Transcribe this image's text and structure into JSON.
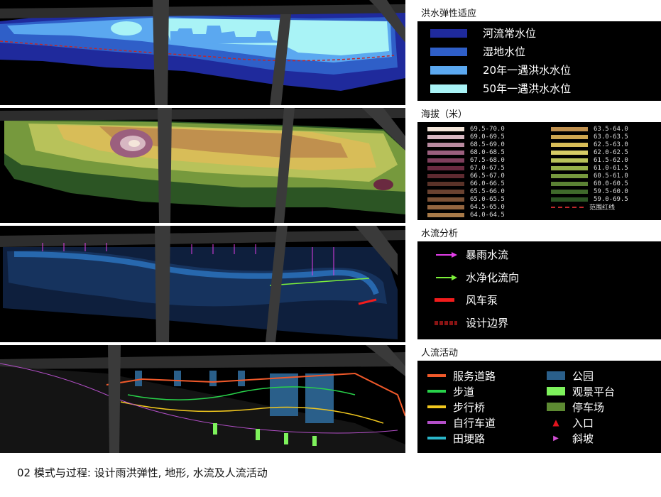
{
  "caption": "02 模式与过程: 设计雨洪弹性, 地形, 水流及人流活动",
  "flood": {
    "title": "洪水弹性适应",
    "items": [
      {
        "label": "河流常水位",
        "color": "#1f2a9c"
      },
      {
        "label": "湿地水位",
        "color": "#2f5fc8"
      },
      {
        "label": "20年一遇洪水水位",
        "color": "#5ba8f0"
      },
      {
        "label": "50年一遇洪水水位",
        "color": "#a9f3f6"
      }
    ]
  },
  "elevation": {
    "title": "海拔（米）",
    "left": [
      {
        "label": "69.5-70.0",
        "color": "#f4e6da"
      },
      {
        "label": "69.0-69.5",
        "color": "#d7b7c2"
      },
      {
        "label": "68.5-69.0",
        "color": "#b98aa0"
      },
      {
        "label": "68.0-68.5",
        "color": "#9b5f7e"
      },
      {
        "label": "67.5-68.0",
        "color": "#7f3f5d"
      },
      {
        "label": "67.0-67.5",
        "color": "#6a2a40"
      },
      {
        "label": "66.5-67.0",
        "color": "#5e2a30"
      },
      {
        "label": "66.0-66.5",
        "color": "#5a3228"
      },
      {
        "label": "65.5-66.0",
        "color": "#6a4230"
      },
      {
        "label": "65.0-65.5",
        "color": "#7c5236"
      },
      {
        "label": "64.5-65.0",
        "color": "#946640"
      },
      {
        "label": "64.0-64.5",
        "color": "#a87a48"
      }
    ],
    "right": [
      {
        "label": "63.5-64.0",
        "color": "#c0904e"
      },
      {
        "label": "63.0-63.5",
        "color": "#cfa650"
      },
      {
        "label": "62.5-63.0",
        "color": "#d8bd58"
      },
      {
        "label": "62.0-62.5",
        "color": "#d6cc66"
      },
      {
        "label": "61.5-62.0",
        "color": "#b8c25a"
      },
      {
        "label": "61.0-61.5",
        "color": "#95b049"
      },
      {
        "label": "60.5-61.0",
        "color": "#76993d"
      },
      {
        "label": "60.0-60.5",
        "color": "#5b8234"
      },
      {
        "label": "59.5-60.0",
        "color": "#3f6a2b"
      },
      {
        "label": "59.0-69.5",
        "color": "#2c5524"
      },
      {
        "label": "范围红线",
        "color": "#c0282c"
      }
    ]
  },
  "waterflow": {
    "title": "水流分析",
    "items": [
      {
        "label": "暴雨水流",
        "color": "#e23ee8"
      },
      {
        "label": "水净化流向",
        "color": "#7cf03a"
      },
      {
        "label": "风车泵",
        "color": "#f21c1c"
      },
      {
        "label": "设计边界",
        "color": "#8a1414"
      }
    ]
  },
  "people": {
    "title": "人流活动",
    "left": [
      {
        "label": "服务道路",
        "color": "#f0592a"
      },
      {
        "label": "步道",
        "color": "#28d24a"
      },
      {
        "label": "步行桥",
        "color": "#f2c81e"
      },
      {
        "label": "自行车道",
        "color": "#b34fc8"
      },
      {
        "label": "田埂路",
        "color": "#2ab6c9"
      }
    ],
    "right": [
      {
        "label": "公园",
        "color": "#2a5f8a"
      },
      {
        "label": "观景平台",
        "color": "#7ef25c"
      },
      {
        "label": "停车场",
        "color": "#5d8a32"
      },
      {
        "label": "入口",
        "color": "#e4141e"
      },
      {
        "label": "斜坡",
        "color": "#d44fd6"
      }
    ]
  }
}
